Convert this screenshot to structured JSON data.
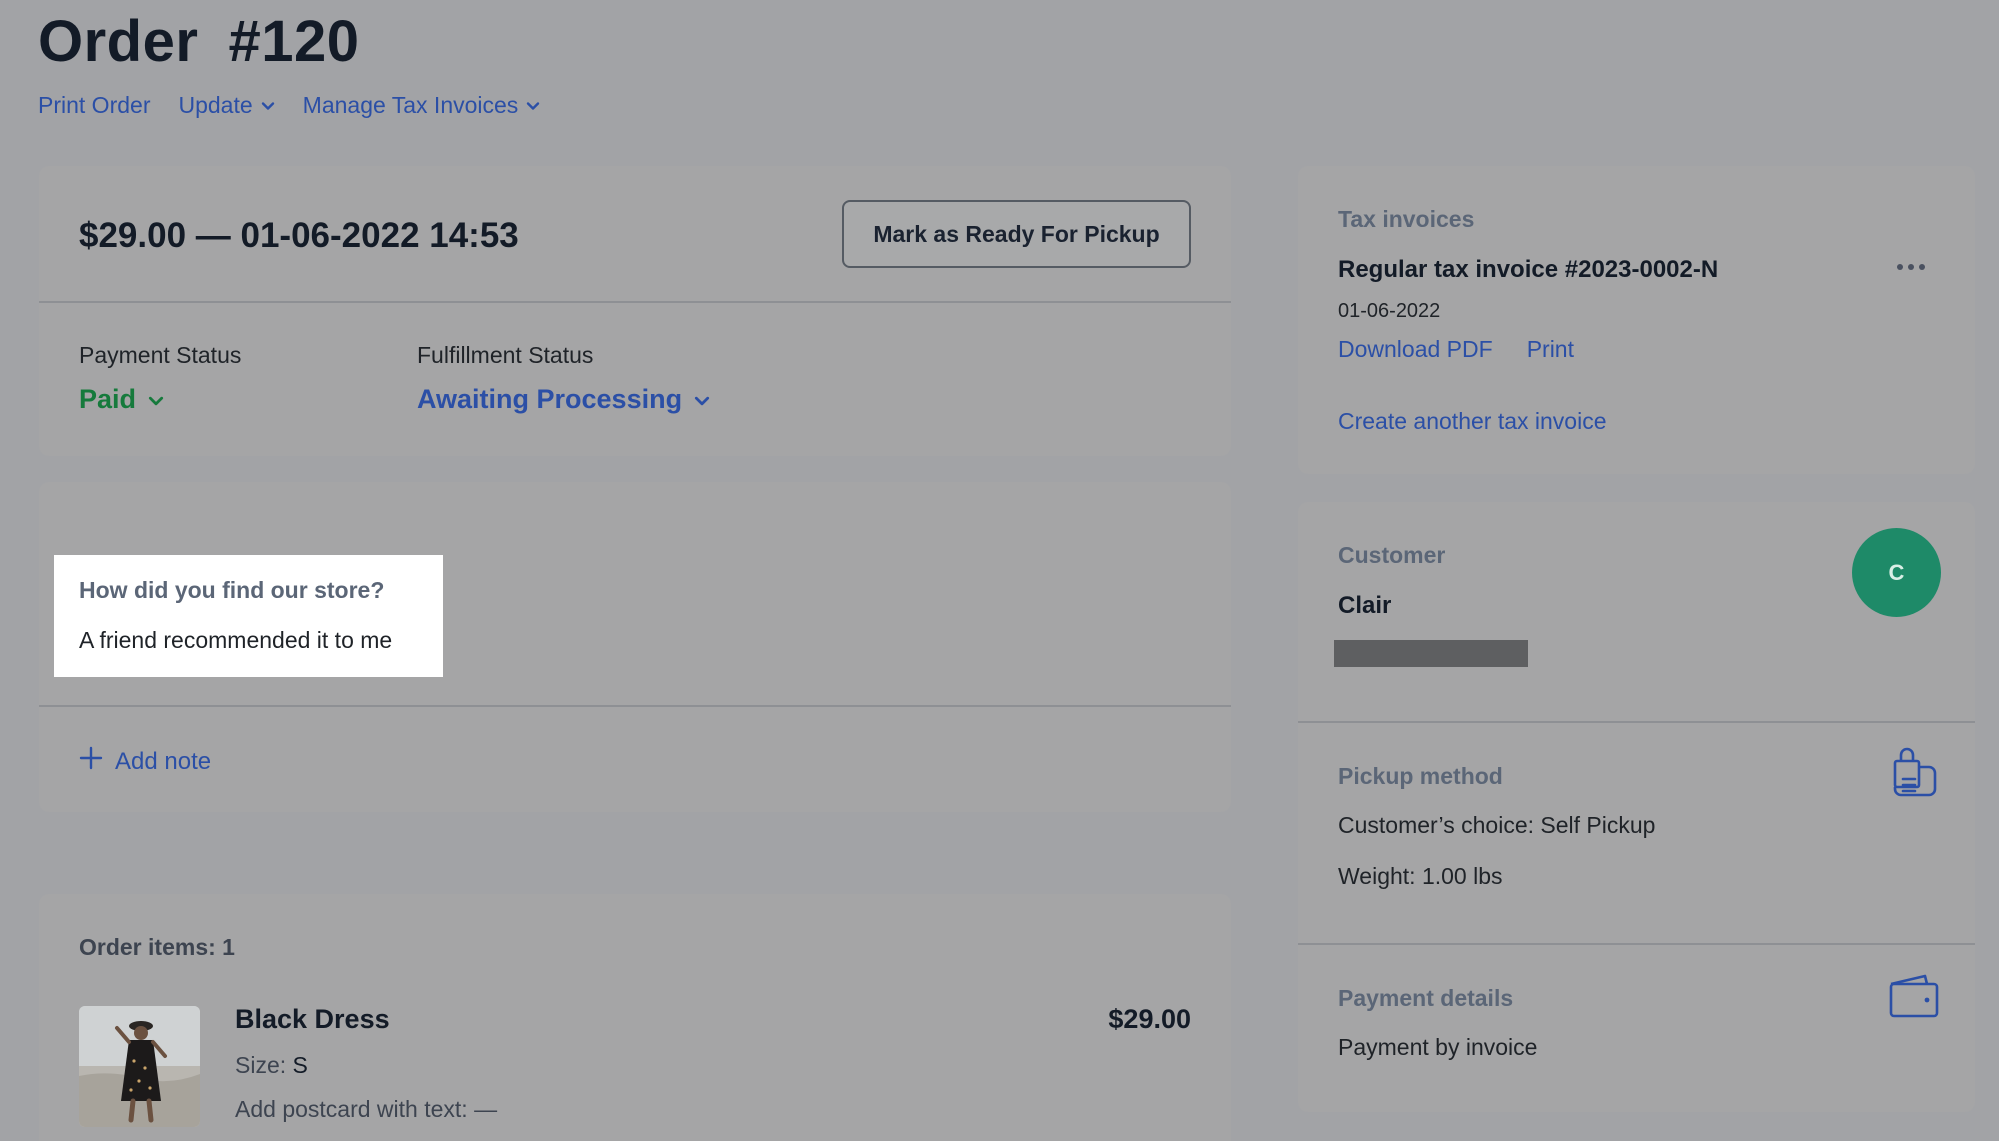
{
  "header": {
    "title_word": "Order",
    "order_number": "#120",
    "actions": {
      "print": "Print Order",
      "update": "Update",
      "manage_tax": "Manage Tax Invoices"
    }
  },
  "order_summary": {
    "amount_date": "$29.00 — 01-06-2022 14:53",
    "ready_button": "Mark as Ready For Pickup",
    "payment_status_label": "Payment Status",
    "payment_status_value": "Paid",
    "fulfillment_status_label": "Fulfillment Status",
    "fulfillment_status_value": "Awaiting Processing"
  },
  "notes": {
    "question": "How did you find our store?",
    "answer": "A friend recommended it to me",
    "add_note": "Add note"
  },
  "items": {
    "title": "Order items: 1",
    "list": [
      {
        "name": "Black Dress",
        "price": "$29.00",
        "size_label": "Size:",
        "size_value": "S",
        "postcard": "Add postcard with text: —"
      }
    ]
  },
  "tax_invoices": {
    "label": "Tax invoices",
    "invoice_name": "Regular tax invoice #2023-0002-N",
    "invoice_date": "01-06-2022",
    "download_pdf": "Download PDF",
    "print": "Print",
    "create_another": "Create another tax invoice"
  },
  "customer": {
    "label": "Customer",
    "name": "Clair",
    "avatar_initial": "C"
  },
  "pickup": {
    "label": "Pickup method",
    "choice": "Customer’s choice: Self Pickup",
    "weight": "Weight: 1.00 lbs"
  },
  "payment": {
    "label": "Payment details",
    "method": "Payment by invoice"
  },
  "icons": {
    "chevron": "chevron-down-icon",
    "plus": "plus-icon",
    "more": "more-horizontal-icon",
    "pickup": "pickup-bag-icon",
    "wallet": "wallet-icon"
  },
  "colors": {
    "link": "#2b4fa6",
    "paid": "#167a3c",
    "avatar": "#1e8a68"
  }
}
